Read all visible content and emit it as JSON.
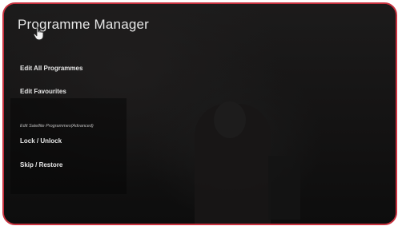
{
  "page": {
    "title": "Programme Manager"
  },
  "menu": {
    "items": [
      {
        "label": "Edit All Programmes"
      },
      {
        "label": "Edit Favourites"
      }
    ],
    "section_label": "Edit Satellite Programmes(Advanced)",
    "advanced_items": [
      {
        "label": "Lock / Unlock"
      },
      {
        "label": "Skip / Restore"
      }
    ]
  },
  "icons": {
    "pointer": "hand-pointer-icon"
  },
  "colors": {
    "frame_border": "#c8323f",
    "background": "#121212",
    "text": "#e8e8e8"
  }
}
